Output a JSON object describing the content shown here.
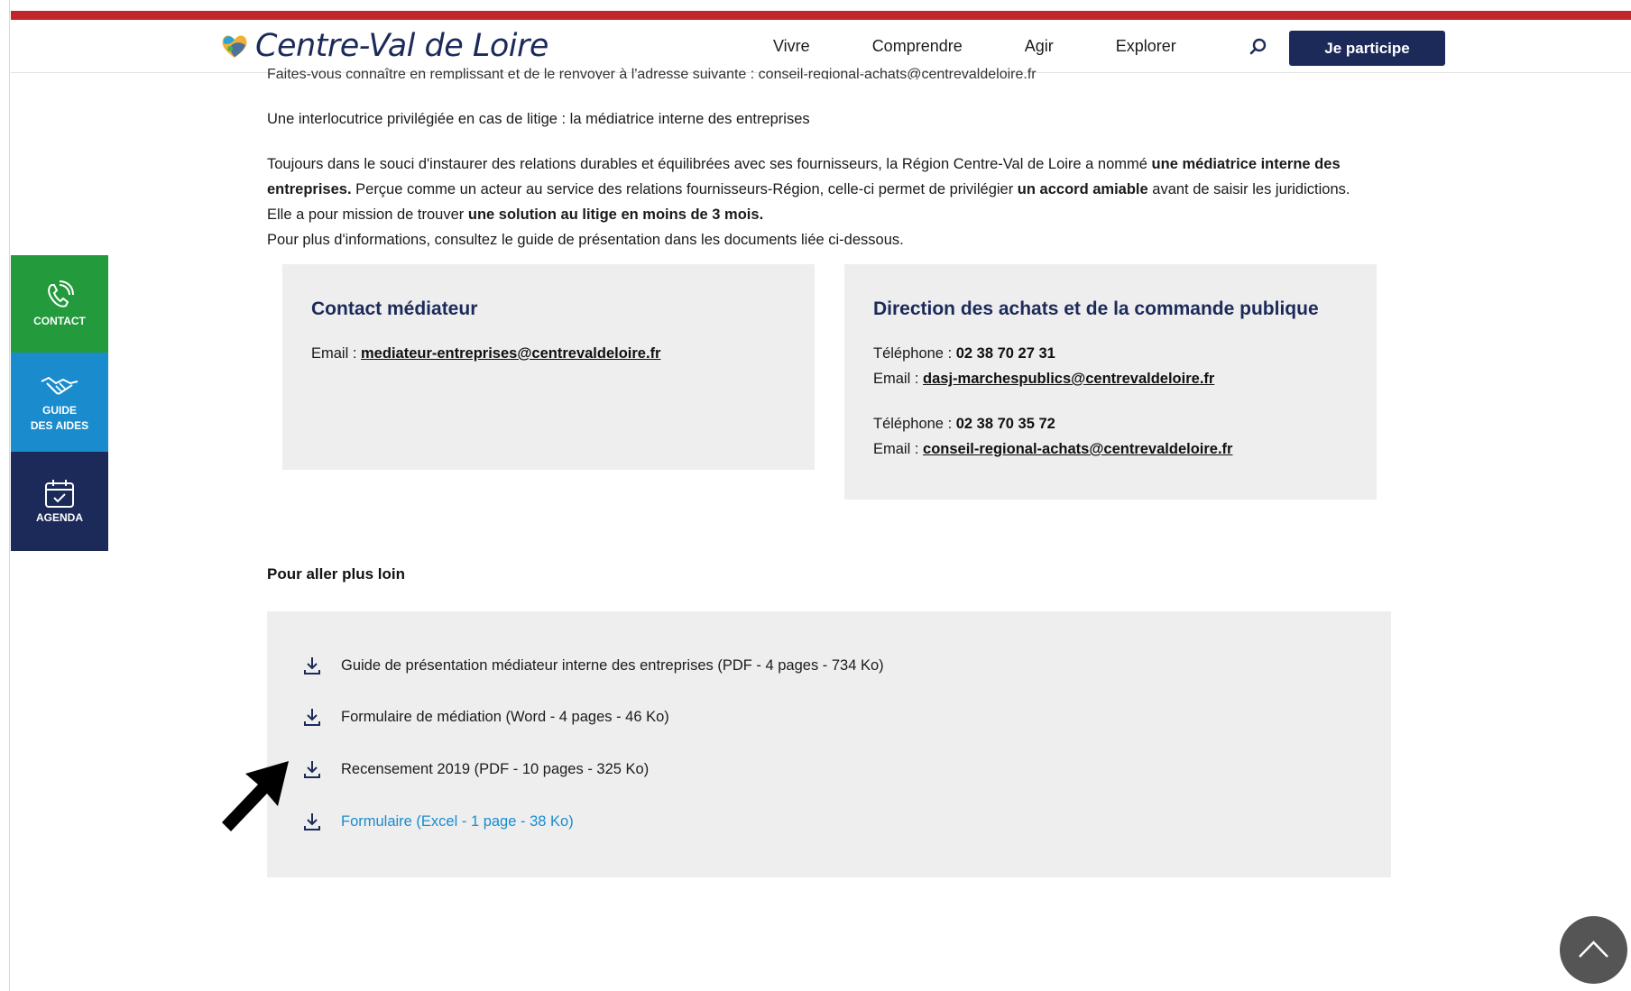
{
  "header": {
    "logo_text": "Centre-Val de Loire",
    "nav": [
      "Vivre",
      "Comprendre",
      "Agir",
      "Explorer"
    ],
    "cta_label": "Je participe",
    "brand_red": "#c0272d",
    "brand_navy": "#1c2a5a"
  },
  "side": {
    "contact": "CONTACT",
    "guide_line1": "GUIDE",
    "guide_line2": "DES AIDES",
    "agenda": "AGENDA"
  },
  "content": {
    "cut_line": "Faites-vous connaître en remplissant et de le renvoyer à l'adresse suivante : conseil-regional-achats@centrevaldeloire.fr",
    "p1": "Une interlocutrice privilégiée en cas de litige : la médiatrice interne des entreprises",
    "p2_a": "Toujours dans le souci d'instaurer des relations durables et équilibrées avec ses fournisseurs, la Région Centre-Val de Loire a nommé ",
    "p2_b": "une médiatrice interne des entreprises.",
    "p2_c": " Perçue comme un acteur au service des relations fournisseurs-Région, celle-ci permet de privilégier ",
    "p2_d": "un accord amiable",
    "p2_e": " avant de saisir les juridictions.",
    "p3_a": "Elle a pour mission de trouver ",
    "p3_b": "une solution au litige en moins de 3 mois.",
    "p4": "Pour plus d'informations, consultez le guide de présentation dans les documents liée ci-dessous."
  },
  "box1": {
    "title": "Contact médiateur",
    "email_label": "Email : ",
    "email": "mediateur-entreprises@centrevaldeloire.fr"
  },
  "box2": {
    "title": "Direction des achats et de la commande publique",
    "tel_label": "Téléphone : ",
    "tel1": "02 38 70 27 31",
    "email_label": "Email : ",
    "email1": "dasj-marchespublics@centrevaldeloire.fr",
    "tel2": "02 38 70 35 72",
    "email2": "conseil-regional-achats@centrevaldeloire.fr"
  },
  "downloads": {
    "title": "Pour aller plus loin",
    "items": [
      "Guide de présentation médiateur interne des entreprises (PDF - 4 pages - 734 Ko)",
      "Formulaire de médiation (Word - 4 pages - 46 Ko)",
      "Recensement 2019 (PDF - 10 pages - 325 Ko)",
      "Formulaire (Excel - 1 page - 38 Ko)"
    ]
  }
}
